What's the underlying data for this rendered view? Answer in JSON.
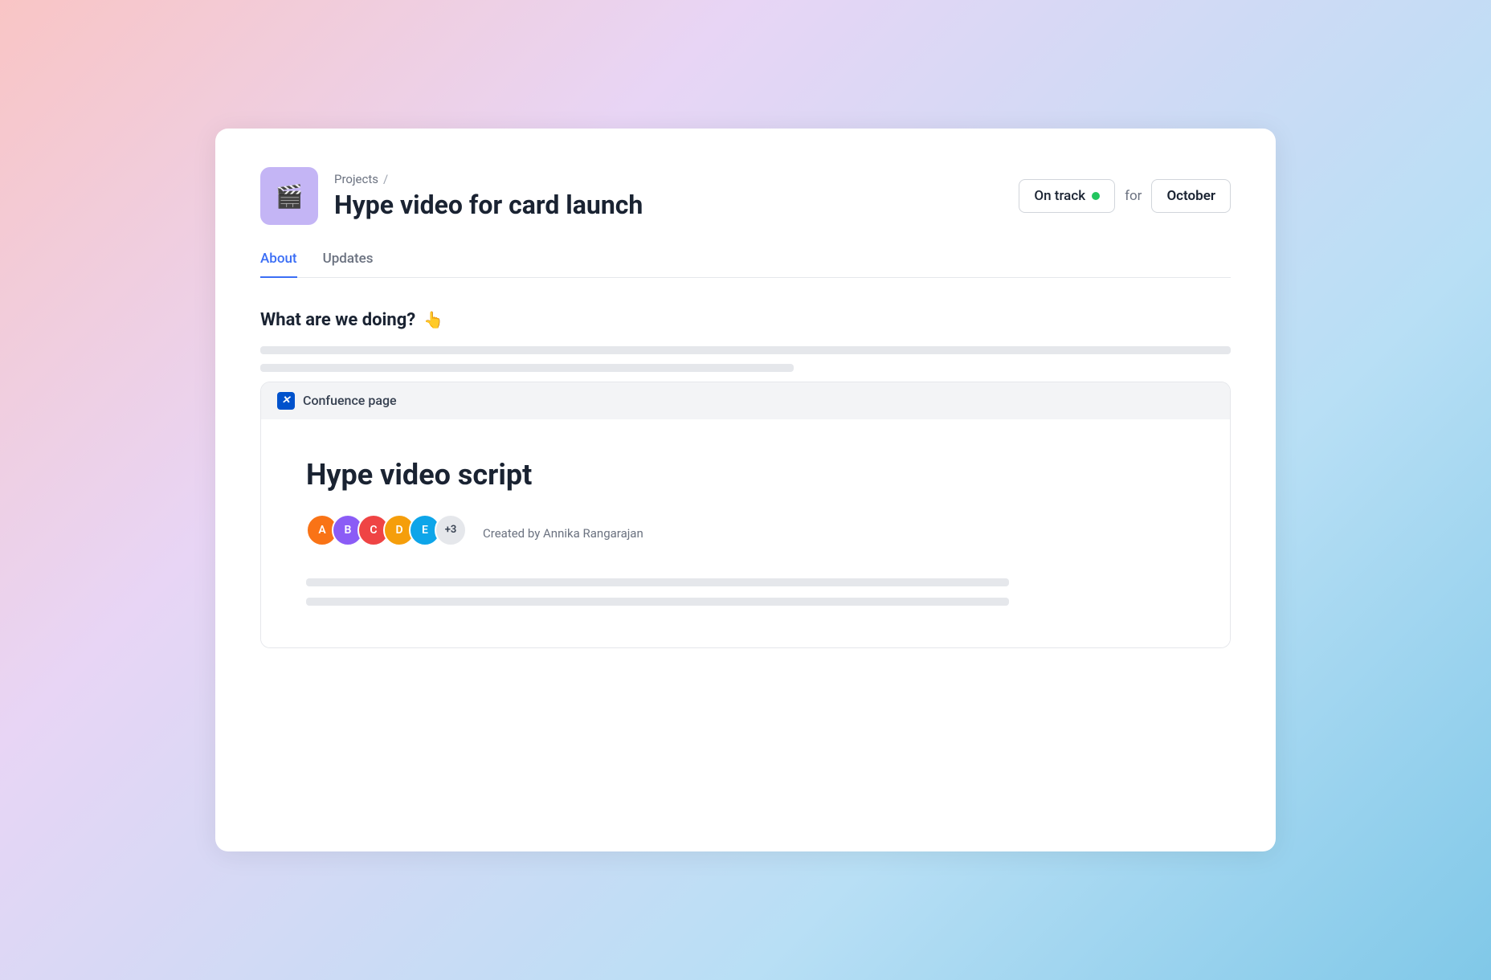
{
  "background": {
    "gradient": "pink-to-blue"
  },
  "header": {
    "breadcrumb": {
      "parent": "Projects",
      "separator": "/"
    },
    "project_title": "Hype video for card launch",
    "project_icon": "🎬",
    "status": {
      "label": "On track",
      "dot_color": "#22c55e"
    },
    "for_text": "for",
    "month": "October"
  },
  "tabs": [
    {
      "label": "About",
      "active": true
    },
    {
      "label": "Updates",
      "active": false
    }
  ],
  "main": {
    "section_heading": "What are we doing?",
    "confluence_card": {
      "header_label": "Confuence page",
      "icon_label": "C",
      "title": "Hype video script",
      "created_by": "Created by Annika Rangarajan",
      "plus_count": "+3"
    }
  }
}
